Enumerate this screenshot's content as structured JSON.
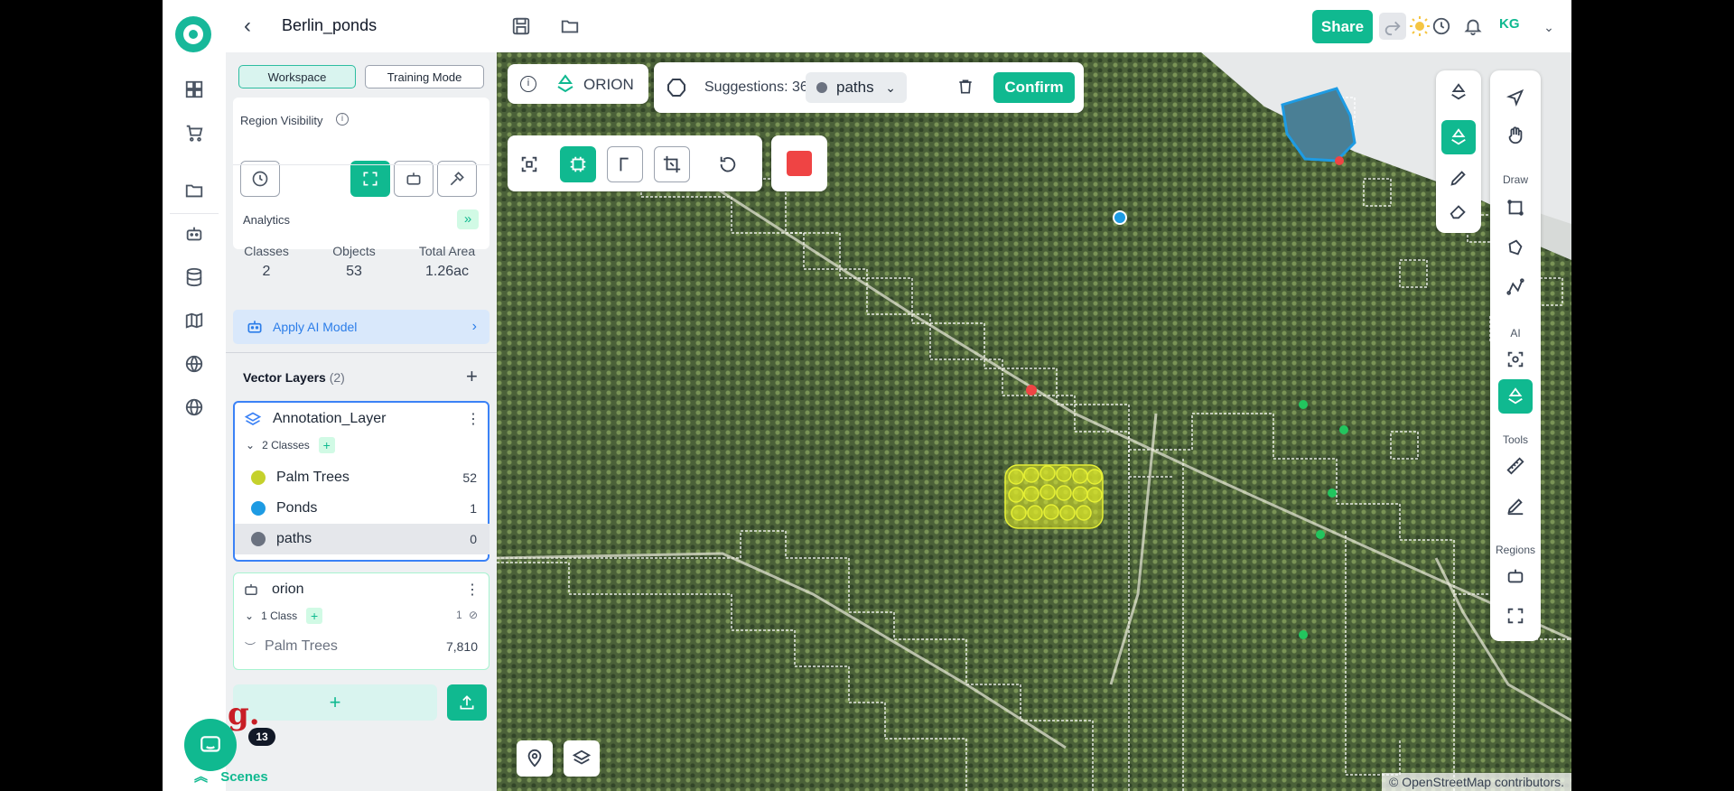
{
  "header": {
    "project_title": "Berlin_ponds",
    "share_label": "Share",
    "avatar_initials": "KG"
  },
  "panel": {
    "workspace_label": "Workspace",
    "training_mode_label": "Training Mode",
    "region_visibility_label": "Region Visibility",
    "analytics_label": "Analytics",
    "stats": [
      {
        "label": "Classes",
        "value": "2"
      },
      {
        "label": "Objects",
        "value": "53"
      },
      {
        "label": "Total Area",
        "value": "1.26ac"
      }
    ],
    "apply_ai_label": "Apply AI Model",
    "vector_layers_label": "Vector Layers",
    "vector_layers_count": "(2)",
    "layers": [
      {
        "name": "Annotation_Layer",
        "classes_label": "2 Classes",
        "classes": [
          {
            "name": "Palm Trees",
            "count": "52",
            "color": "#c5d12c"
          },
          {
            "name": "Ponds",
            "count": "1",
            "color": "#1e9be3"
          },
          {
            "name": "paths",
            "count": "0",
            "color": "#6b7280"
          }
        ]
      },
      {
        "name": "orion",
        "classes_label": "1 Class",
        "hidden_count": "1",
        "classes": [
          {
            "name": "Palm Trees",
            "count": "7,810"
          }
        ]
      }
    ],
    "notification_badge": "13",
    "brand_letter": "g.",
    "scenes_label": "Scenes"
  },
  "map": {
    "orion_label": "ORION",
    "suggestions_label": "Suggestions: 36",
    "class_select_value": "paths",
    "confirm_label": "Confirm",
    "right_tools": {
      "draw_label": "Draw",
      "ai_label": "AI",
      "tools_label": "Tools",
      "regions_label": "Regions"
    },
    "attribution": "© OpenStreetMap contributors."
  },
  "colors": {
    "accent": "#10b990",
    "ai_blue": "#2b7de9",
    "palm_yellow": "#c5d12c",
    "pond_blue": "#1e9be3",
    "stop_red": "#ef4444"
  }
}
